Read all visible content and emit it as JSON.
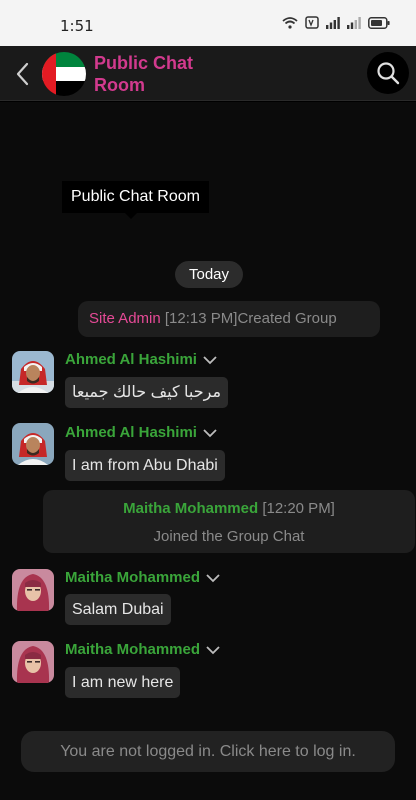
{
  "status_bar": {
    "time": "1:51"
  },
  "header": {
    "title_line1": "Public Chat",
    "title_line2": "Room"
  },
  "tooltip": {
    "text": "Public Chat Room"
  },
  "date_divider": {
    "label": "Today"
  },
  "system_messages": [
    {
      "sender": "Site Admin",
      "time": "[12:13 PM]",
      "text": "Created Group"
    },
    {
      "sender": "Maitha Mohammed",
      "time": "[12:20 PM]",
      "text": "Joined the Group Chat"
    }
  ],
  "messages": [
    {
      "sender": "Ahmed Al Hashimi",
      "text": "مرحبا كيف حالك جميعا"
    },
    {
      "sender": "Ahmed Al Hashimi",
      "text": "I am from Abu Dhabi"
    },
    {
      "sender": "Maitha Mohammed",
      "text": "Salam Dubai"
    },
    {
      "sender": "Maitha Mohammed",
      "text": "I am new here"
    }
  ],
  "login_prompt": {
    "text": "You are not logged in. Click here to log in."
  },
  "colors": {
    "title": "#d23a8e",
    "admin": "#e54a96",
    "user": "#3aa53a",
    "background": "#0b0b0b"
  }
}
